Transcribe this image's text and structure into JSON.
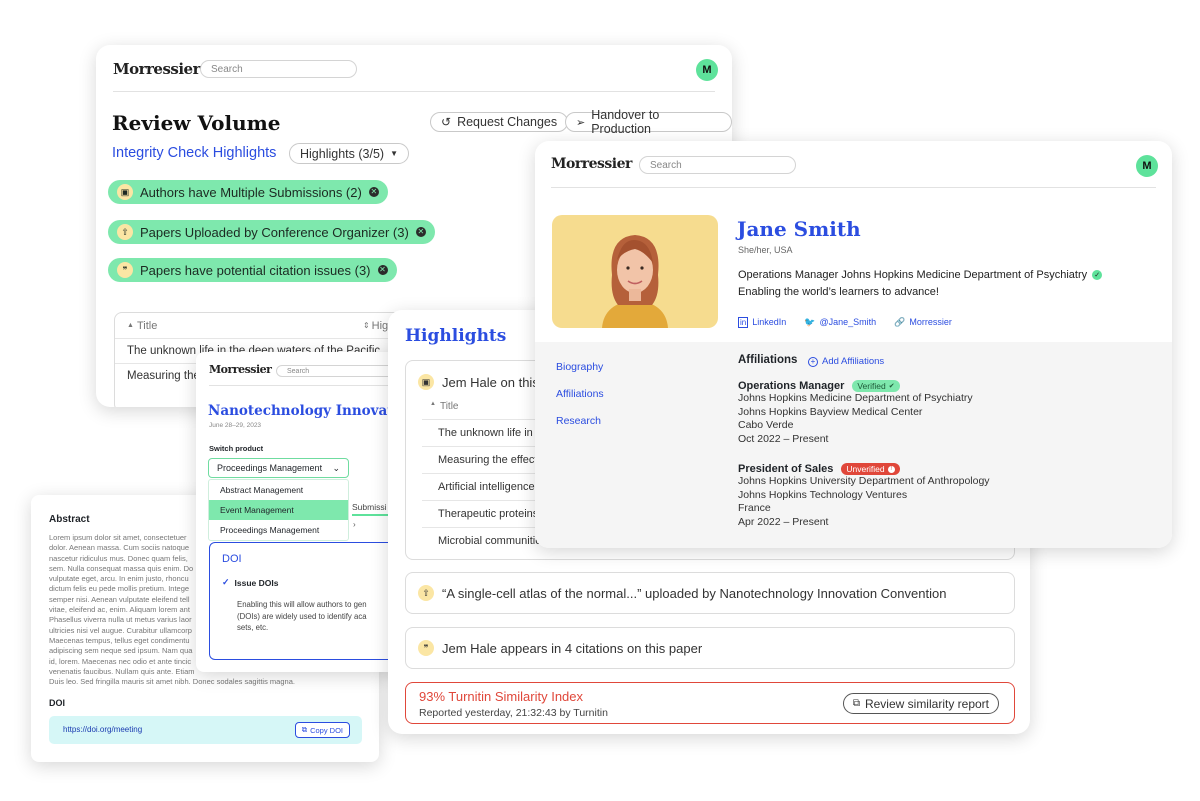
{
  "brand": "Morressier",
  "search_placeholder": "Search",
  "avatar_initial": "M",
  "review": {
    "title": "Review Volume",
    "request_changes": "Request Changes",
    "handover": "Handover to Production",
    "subtitle": "Integrity Check Highlights",
    "highlights_select": "Highlights (3/5)",
    "pills": [
      "Authors have Multiple Submissions (2)",
      "Papers Uploaded by Conference Organizer (3)",
      "Papers have potential citation issues (3)"
    ],
    "table": {
      "col_title": "Title",
      "col_high": "High",
      "rows": [
        "The unknown life in the deep waters of the Pacific...",
        "Measuring the"
      ]
    }
  },
  "event": {
    "title": "Nanotechnology Innovatio",
    "date": "June 28–29, 2023",
    "switch_label": "Switch product",
    "selected": "Proceedings Management",
    "options": [
      "Abstract Management",
      "Event Management",
      "Proceedings Management"
    ],
    "submission_tab": "Submissi",
    "doi_title": "DOI",
    "issue_dois": "Issue DOIs",
    "doi_desc_1": "Enabling this will allow authors to gen",
    "doi_desc_2": "(DOIs) are widely used to identify aca",
    "doi_desc_3": "sets, etc."
  },
  "abstract": {
    "heading": "Abstract",
    "lines": [
      "Lorem ipsum dolor sit amet, consectetuer",
      "dolor. Aenean massa. Cum sociis natoque",
      "nascetur ridiculus mus. Donec quam felis,",
      "sem. Nulla consequat massa quis enim. Do",
      "vulputate eget, arcu. In enim justo, rhoncu",
      "dictum felis eu pede mollis pretium. Intege",
      "semper nisi. Aenean vulputate eleifend tell",
      "vitae, eleifend ac, enim. Aliquam lorem ant",
      "Phasellus viverra nulla ut metus varius laor",
      "ultricies nisi vel augue. Curabitur ullamcorp",
      "Maecenas tempus, tellus eget condimentu",
      "adipiscing sem neque sed ipsum. Nam qua",
      "id, lorem. Maecenas nec odio et ante tincic",
      "venenatis faucibus. Nullam quis ante. Etiam",
      "Duis leo. Sed fringilla mauris sit amet nibh. Donec sodales sagittis magna."
    ],
    "doi_heading": "DOI",
    "doi_url": "https://doi.org/meeting",
    "copy_doi": "Copy DOI"
  },
  "highlights": {
    "title": "Highlights",
    "item1": "Jem Hale on this",
    "col_title": "Title",
    "rows": [
      "The unknown life in th",
      "Measuring the effect",
      "Artificial intelligence a",
      "Therapeutic proteins",
      "Microbial communitie"
    ],
    "item2": "“A single-cell atlas of the normal...” uploaded by Nanotechnology Innovation Convention",
    "item3": "Jem Hale appears in 4 citations on this paper",
    "turnitin_title": "93% Turnitin Similarity Index",
    "turnitin_sub": "Reported yesterday, 21:32:43 by Turnitin",
    "review_report": "Review similarity report"
  },
  "profile": {
    "name": "Jane Smith",
    "pronouns": "She/her, USA",
    "headline": "Operations Manager Johns Hopkins Medicine Department of Psychiatry",
    "tagline": "Enabling the world’s learners to advance!",
    "linkedin": "LinkedIn",
    "twitter": "@Jane_Smith",
    "website": "Morressier",
    "nav": [
      "Biography",
      "Affiliations",
      "Research"
    ],
    "affiliations_title": "Affiliations",
    "add_affiliations": "Add Affiliations",
    "aff1": {
      "role": "Operations Manager",
      "badge": "Verified",
      "lines": [
        "Johns Hopkins Medicine Department of Psychiatry",
        "Johns Hopkins  Bayview Medical Center",
        "Cabo Verde",
        "Oct 2022 – Present"
      ]
    },
    "aff2": {
      "role": "President of Sales",
      "badge": "Unverified",
      "lines": [
        "Johns Hopkins University Department of Anthropology",
        "Johns Hopkins Technology Ventures",
        "France",
        "Apr 2022 – Present"
      ]
    }
  },
  "colors": {
    "accent_blue": "#2b4de0",
    "pill_green": "#7ee8ad",
    "alert_red": "#e0473a",
    "photo_bg": "#f6dc8f"
  }
}
